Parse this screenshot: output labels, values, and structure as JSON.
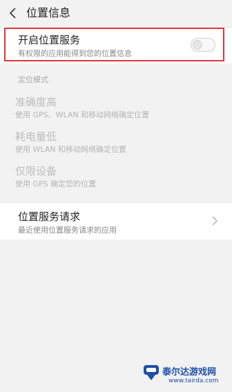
{
  "header": {
    "title": "位置信息",
    "back_icon": "chevron-left-icon"
  },
  "location_service": {
    "title": "开启位置服务",
    "subtitle": "有权限的应用能得到您的位置信息",
    "enabled": false
  },
  "positioning": {
    "section_label": "定位模式",
    "modes": [
      {
        "title": "准确度高",
        "subtitle": "使用 GPS、WLAN 和移动网络确定位置"
      },
      {
        "title": "耗电量低",
        "subtitle": "使用 WLAN 和移动网络确定位置"
      },
      {
        "title": "仅限设备",
        "subtitle": "使用 GPS 确定您的位置"
      }
    ]
  },
  "requests": {
    "title": "位置服务请求",
    "subtitle": "最近使用位置服务请求的应用",
    "chevron_icon": "chevron-right-icon"
  },
  "watermark": {
    "name": "泰尔达游戏网",
    "url": "www.tairda.com"
  },
  "colors": {
    "highlight": "#e0333b",
    "background": "#f2f2f2",
    "watermark": "#1f4fa8"
  }
}
